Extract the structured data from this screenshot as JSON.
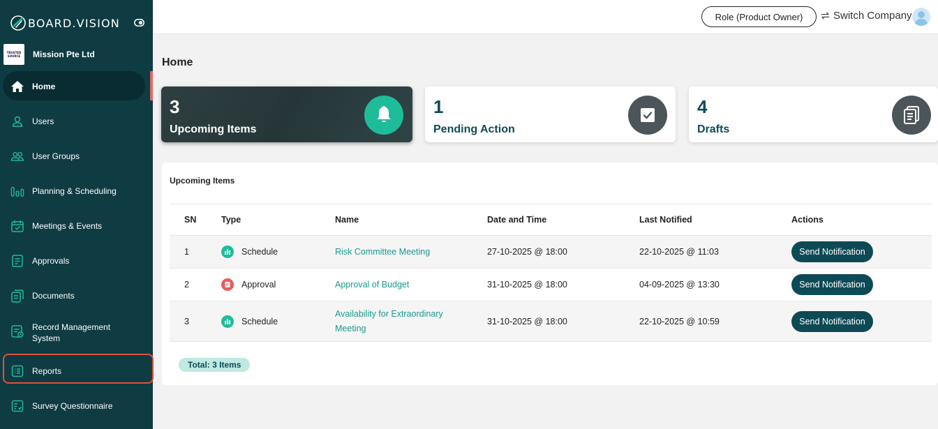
{
  "brand": {
    "name": "BOARD.VISION"
  },
  "company": {
    "logo_text": "TRUSTED SOURCE",
    "name": "Mission Pte Ltd"
  },
  "sidebar": {
    "items": [
      {
        "label": "Home",
        "icon": "home-icon",
        "active": true
      },
      {
        "label": "Users",
        "icon": "user-icon"
      },
      {
        "label": "User Groups",
        "icon": "users-icon"
      },
      {
        "label": "Planning & Scheduling",
        "icon": "bars-chart-icon"
      },
      {
        "label": "Meetings & Events",
        "icon": "calendar-check-icon"
      },
      {
        "label": "Approvals",
        "icon": "approval-doc-icon"
      },
      {
        "label": "Documents",
        "icon": "documents-icon"
      },
      {
        "label": "Record Management System",
        "icon": "record-icon"
      },
      {
        "label": "Reports",
        "icon": "reports-icon",
        "highlighted": true
      },
      {
        "label": "Survey Questionnaire",
        "icon": "survey-icon"
      }
    ]
  },
  "topbar": {
    "role_label": "Role (Product Owner)",
    "switch_label": "Switch Company"
  },
  "page": {
    "title": "Home"
  },
  "stats": [
    {
      "count": "3",
      "label": "Upcoming Items",
      "icon": "bell-icon"
    },
    {
      "count": "1",
      "label": "Pending Action",
      "icon": "check-box-icon"
    },
    {
      "count": "4",
      "label": "Drafts",
      "icon": "drafts-icon"
    }
  ],
  "upcoming": {
    "title": "Upcoming Items",
    "columns": [
      "SN",
      "Type",
      "Name",
      "Date and Time",
      "Last Notified",
      "Actions"
    ],
    "rows": [
      {
        "sn": "1",
        "type": "Schedule",
        "type_icon": "schedule-icon",
        "name": "Risk Committee Meeting",
        "date": "27-10-2025 @ 18:00",
        "last": "22-10-2025 @ 11:03",
        "action": "Send Notification"
      },
      {
        "sn": "2",
        "type": "Approval",
        "type_icon": "approval-icon",
        "name": "Approval of Budget",
        "date": "31-10-2025 @ 18:00",
        "last": "04-09-2025 @ 13:30",
        "action": "Send Notification"
      },
      {
        "sn": "3",
        "type": "Schedule",
        "type_icon": "schedule-icon",
        "name_line1": "Availability for Extraordinary",
        "name_line2": "Meeting",
        "date": "31-10-2025 @ 18:00",
        "last": "22-10-2025 @ 10:59",
        "action": "Send Notification"
      }
    ],
    "total": "Total: 3 Items"
  },
  "colors": {
    "sidebar": "#0f3b43",
    "accent": "#1fbc9a",
    "primary": "#0e4a55",
    "link": "#1a9a8e",
    "highlight": "#e0503e"
  }
}
